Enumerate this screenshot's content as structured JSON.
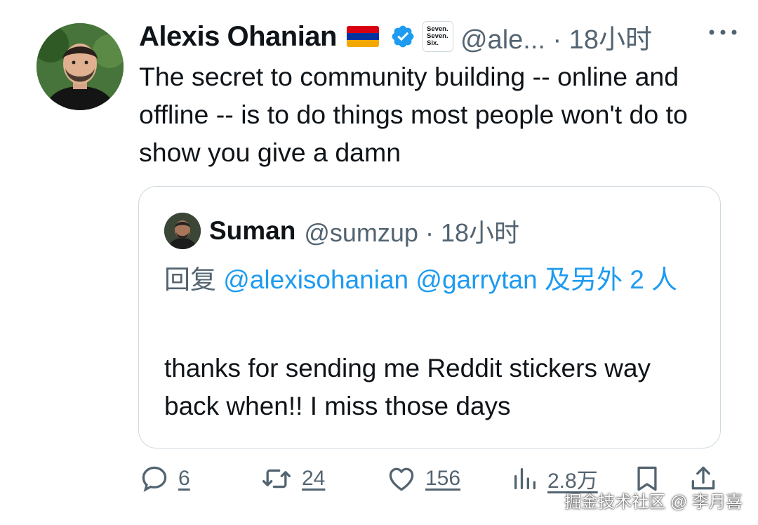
{
  "tweet": {
    "author_name": "Alexis Ohanian",
    "flag_icon": "armenia-flag-icon",
    "affiliate_label": [
      "Seven.",
      "Seven.",
      "Six."
    ],
    "handle_time": "@ale... · 18小时",
    "text": "The secret to community building -- online and offline -- is to do things most people won't do to show you give a damn"
  },
  "quote": {
    "author_name": "Suman",
    "handle_time": "@sumzup · 18小时",
    "reply_prefix": "回复 ",
    "reply_mentions": "@alexisohanian @garrytan 及另外 2 人",
    "text": "thanks for sending me Reddit stickers way back when!! I miss those days"
  },
  "actions": {
    "replies": "6",
    "retweets": "24",
    "likes": "156",
    "views": "2.8万"
  },
  "watermark": "掘金技术社区 @ 李月喜",
  "colors": {
    "accent": "#1d9bf0",
    "secondary_text": "#536471",
    "border": "#cfd9de"
  }
}
